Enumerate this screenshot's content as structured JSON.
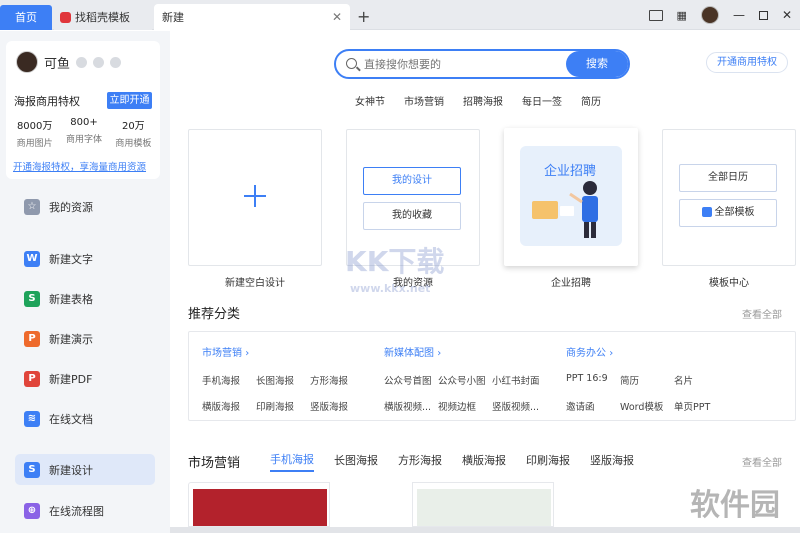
{
  "tabs": {
    "home": "首页",
    "templates": "找稻壳模板",
    "current": "新建"
  },
  "colors": {
    "accent": "#3d7ff5",
    "sidebar_bg": "#f3f5f8"
  },
  "user": {
    "name": "可鱼",
    "privilege_title": "海报商用特权",
    "open_button": "立即开通",
    "stats": [
      {
        "num": "8000万",
        "label": "商用图片"
      },
      {
        "num": "800+",
        "label": "商用字体"
      },
      {
        "num": "20万",
        "label": "商用模板"
      }
    ],
    "privilege_link": "开通海报特权，享海量商用资源"
  },
  "sidebar": {
    "items": [
      {
        "label": "我的资源",
        "icon": "star-icon"
      },
      {
        "label": "新建文字",
        "icon": "writer-icon"
      },
      {
        "label": "新建表格",
        "icon": "spreadsheet-icon"
      },
      {
        "label": "新建演示",
        "icon": "presentation-icon"
      },
      {
        "label": "新建PDF",
        "icon": "pdf-icon"
      },
      {
        "label": "在线文档",
        "icon": "online-doc-icon"
      },
      {
        "label": "新建设计",
        "icon": "design-icon"
      },
      {
        "label": "在线流程图",
        "icon": "flowchart-icon"
      }
    ]
  },
  "search": {
    "placeholder": "直接搜你想要的",
    "button": "搜索"
  },
  "vip_button": "开通商用特权",
  "hot_words": [
    "女神节",
    "市场营销",
    "招聘海报",
    "每日一签",
    "简历"
  ],
  "cards": {
    "blank": "新建空白设计",
    "my_design": "我的设计",
    "my_favorites": "我的收藏",
    "my_resources": "我的资源",
    "enterprise_title": "企业招聘",
    "enterprise_label": "企业招聘",
    "all_calendar": "全部日历",
    "all_templates": "全部模板",
    "template_center": "模板中心"
  },
  "recommend": {
    "title": "推荐分类",
    "see_all": "查看全部",
    "columns": [
      {
        "head": "市场营销",
        "items": [
          "手机海报",
          "长图海报",
          "方形海报",
          "横版海报",
          "印刷海报",
          "竖版海报"
        ]
      },
      {
        "head": "新媒体配图",
        "items": [
          "公众号首图",
          "公众号小图",
          "小红书封面",
          "横版视频...",
          "视频边框",
          "竖版视频..."
        ]
      },
      {
        "head": "商务办公",
        "items": [
          "PPT 16:9",
          "简历",
          "名片",
          "邀请函",
          "Word模板",
          "单页PPT"
        ]
      }
    ]
  },
  "market": {
    "title": "市场营销",
    "see_all": "查看全部",
    "tabs": [
      "手机海报",
      "长图海报",
      "方形海报",
      "横版海报",
      "印刷海报",
      "竖版海报"
    ]
  },
  "watermarks": {
    "kk": "KK下载",
    "kk_url": "www.kkx.net",
    "soft": "软件园"
  }
}
